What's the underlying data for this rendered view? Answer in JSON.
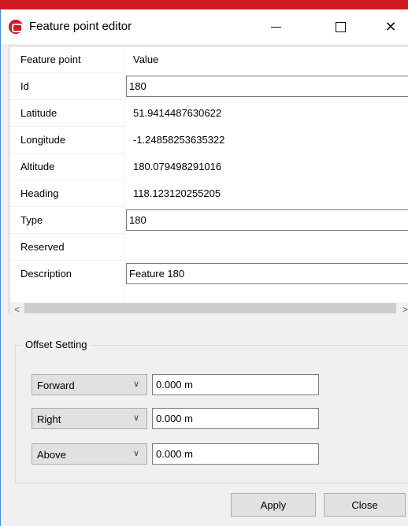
{
  "window": {
    "title": "Feature point editor",
    "accent": "#d0191f"
  },
  "grid": {
    "headers": {
      "key": "Feature point",
      "value": "Value"
    },
    "rows": [
      {
        "key": "Id",
        "value": "180",
        "editable": true
      },
      {
        "key": "Latitude",
        "value": "51.9414487630622",
        "editable": false
      },
      {
        "key": "Longitude",
        "value": "-1.24858253635322",
        "editable": false
      },
      {
        "key": "Altitude",
        "value": "180.079498291016",
        "editable": false
      },
      {
        "key": "Heading",
        "value": "118.123120255205",
        "editable": false
      },
      {
        "key": "Type",
        "value": "180",
        "editable": true
      },
      {
        "key": "Reserved",
        "value": "",
        "editable": false
      },
      {
        "key": "Description",
        "value": "Feature 180",
        "editable": true
      }
    ]
  },
  "offset": {
    "label": "Offset Setting",
    "rows": [
      {
        "direction": "Forward",
        "value": "0.000 m"
      },
      {
        "direction": "Right",
        "value": "0.000 m"
      },
      {
        "direction": "Above",
        "value": "0.000 m"
      }
    ]
  },
  "buttons": {
    "apply": "Apply",
    "close": "Close"
  },
  "icons": [
    "app-icon",
    "minimize-icon",
    "maximize-icon",
    "close-icon",
    "scroll-left-icon",
    "scroll-right-icon",
    "chevron-down-icon"
  ]
}
